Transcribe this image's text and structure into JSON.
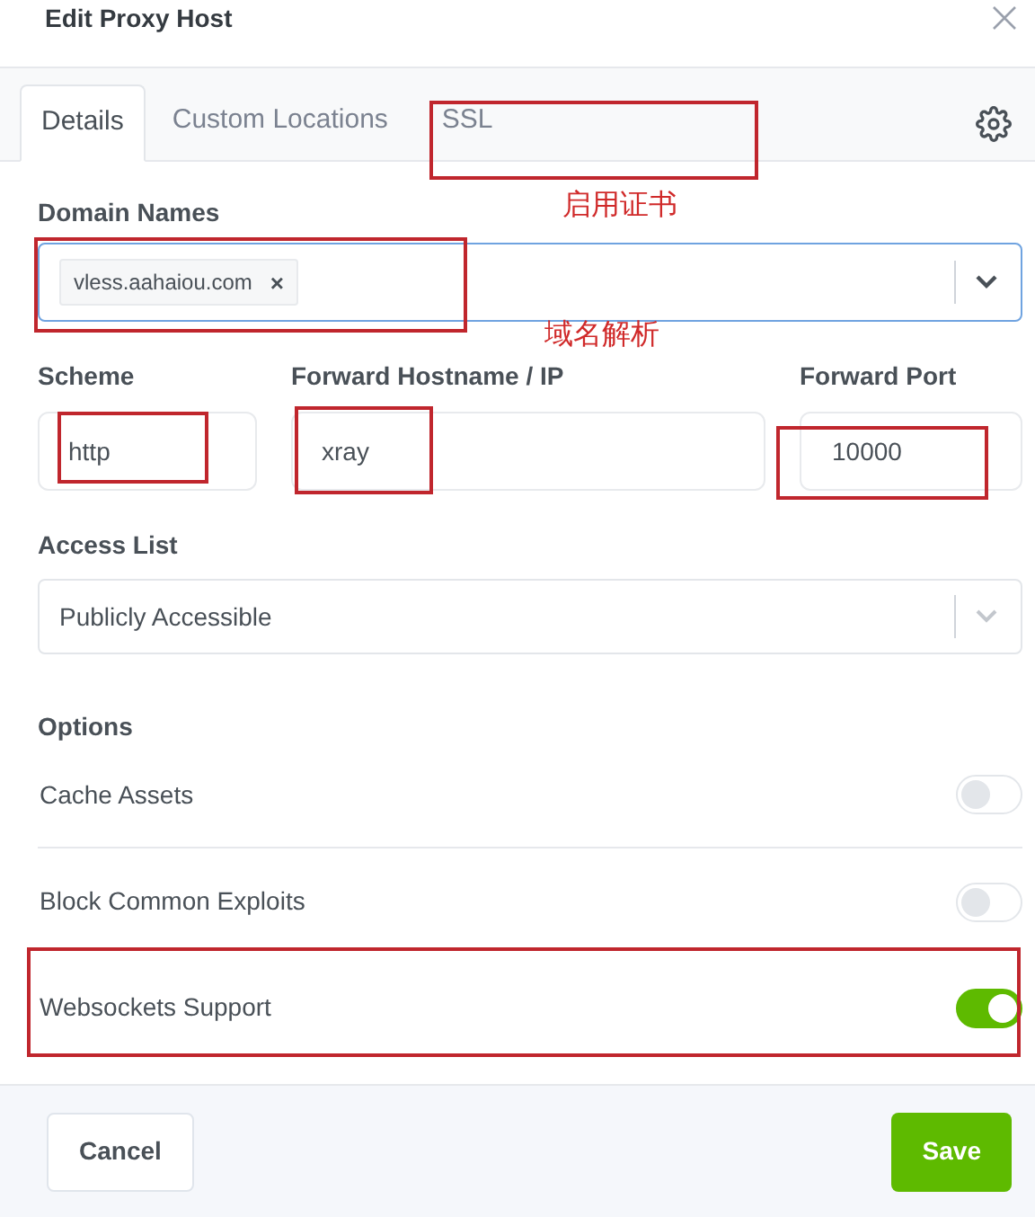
{
  "dialog": {
    "title": "Edit Proxy Host"
  },
  "tabs": [
    {
      "label": "Details",
      "selected": true
    },
    {
      "label": "Custom Locations",
      "selected": false
    },
    {
      "label": "SSL",
      "selected": false
    }
  ],
  "domain_names": {
    "label": "Domain Names",
    "tags": [
      {
        "text": "vless.aahaiou.com",
        "remove": "×"
      }
    ]
  },
  "fields": [
    {
      "label": "Scheme",
      "value": "http"
    },
    {
      "label": "Forward Hostname / IP",
      "value": "xray"
    },
    {
      "label": "Forward Port",
      "value": "10000"
    }
  ],
  "access_list": {
    "label": "Access List",
    "value": "Publicly Accessible"
  },
  "options": {
    "title": "Options",
    "items": [
      {
        "label": "Cache Assets",
        "on": false
      },
      {
        "label": "Block Common Exploits",
        "on": false
      },
      {
        "label": "Websockets Support",
        "on": true
      }
    ]
  },
  "buttons": [
    {
      "label": "Cancel",
      "kind": "secondary"
    },
    {
      "label": "Save",
      "kind": "primary"
    }
  ],
  "annotations": [
    {
      "text": "启用证书"
    },
    {
      "text": "域名解析"
    }
  ]
}
